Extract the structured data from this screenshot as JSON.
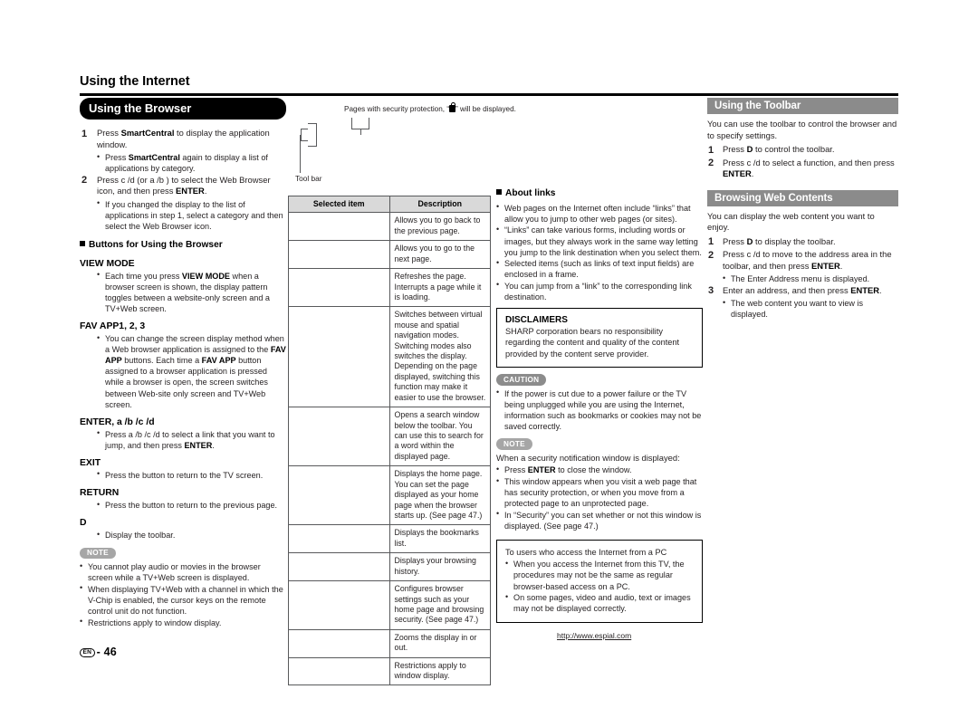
{
  "header": {
    "chapter_title": "Using the Internet"
  },
  "left_column": {
    "section_title": "Using the Browser",
    "steps": [
      {
        "num": "1",
        "text_parts": [
          "Press ",
          "SmartCentral",
          " to display the application window."
        ],
        "bullets": [
          {
            "parts": [
              "Press ",
              "SmartCentral",
              " again to display a list of applications by category."
            ]
          }
        ]
      },
      {
        "num": "2",
        "text_parts": [
          "Press c /d (or a /b ) to select the Web Browser icon, and then press ",
          "ENTER",
          "."
        ],
        "bullets": [
          {
            "parts": [
              "If you changed the display to the list of applications in step 1, select a category and then select the Web Browser icon."
            ]
          }
        ]
      }
    ],
    "buttons_heading": "Buttons for Using the Browser",
    "button_entries": [
      {
        "keyword": "VIEW MODE",
        "bullets": [
          {
            "parts": [
              "Each time you press ",
              "VIEW MODE",
              " when a browser screen is shown, the display pattern toggles between a website-only screen and a TV+Web screen."
            ]
          }
        ]
      },
      {
        "keyword": "FAV APP1, 2, 3",
        "bullets": [
          {
            "parts": [
              "You can change the screen display method when a Web browser application is assigned to the ",
              "FAV APP",
              " buttons. Each time a ",
              "FAV APP",
              " button assigned to a browser application is pressed while a browser is open, the screen switches between Web-site only screen and TV+Web screen."
            ]
          }
        ]
      },
      {
        "keyword": "ENTER, a /b /c /d",
        "bullets": [
          {
            "parts": [
              "Press a /b /c /d  to select a link that you want to jump, and then press ",
              "ENTER",
              "."
            ]
          }
        ]
      },
      {
        "keyword": "EXIT",
        "bullets": [
          {
            "parts": [
              "Press the button to return to the TV screen."
            ]
          }
        ]
      },
      {
        "keyword": "RETURN",
        "bullets": [
          {
            "parts": [
              "Press the button to return to the previous page."
            ]
          }
        ]
      },
      {
        "keyword": "D",
        "bullets": [
          {
            "parts": [
              "Display the toolbar."
            ]
          }
        ]
      }
    ],
    "note_badge": "NOTE",
    "notes": [
      {
        "parts": [
          "You cannot play audio or movies in the browser screen while a TV+Web screen is displayed."
        ]
      },
      {
        "parts": [
          "When displaying TV+Web with a channel in which the V-Chip is enabled, the cursor keys on the remote control unit do not function."
        ]
      },
      {
        "parts": [
          "Restrictions apply to window display."
        ]
      }
    ]
  },
  "mid_column": {
    "diagram": {
      "caption_before": "Pages with security protection, “",
      "caption_icon": "lock-icon",
      "caption_after": "” will be displayed.",
      "toolbar_label": "Tool bar"
    },
    "table": {
      "headers": [
        "Selected item",
        "Description"
      ],
      "rows": [
        {
          "selected_item": "",
          "description": "Allows you to go back to the previous page."
        },
        {
          "selected_item": "",
          "description": "Allows you to go to the next page."
        },
        {
          "selected_item": "",
          "description": "Refreshes the page.\nInterrupts a page while it is loading."
        },
        {
          "selected_item": "",
          "description": "Switches between virtual mouse and spatial navigation modes. Switching modes also switches the display. Depending on the page displayed, switching this function may make it easier to use the browser."
        },
        {
          "selected_item": "",
          "description": "Opens a search window below the toolbar. You can use this to search for a word within the displayed page."
        },
        {
          "selected_item": "",
          "description": "Displays the home page. You can set the page displayed as your home page when the browser starts up. (See page 47.)"
        },
        {
          "selected_item": "",
          "description": "Displays the bookmarks list."
        },
        {
          "selected_item": "",
          "description": "Displays your browsing history."
        },
        {
          "selected_item": "",
          "description": "Configures browser settings such as your home page and browsing security. (See page 47.)"
        },
        {
          "selected_item": "",
          "description": "Zooms the display in or out."
        },
        {
          "selected_item": "",
          "description": "Restrictions apply to window display."
        }
      ]
    }
  },
  "right_column": {
    "about_links_heading": "About links",
    "about_links": [
      {
        "parts": [
          "Web pages on the Internet often include “links” that allow you to jump to other web pages (or sites)."
        ]
      },
      {
        "parts": [
          "“Links” can take various forms, including words or images, but they always work in the same way letting you jump to the link destination when you select them."
        ]
      },
      {
        "parts": [
          "Selected items (such as links of text input fields) are enclosed in a frame."
        ]
      },
      {
        "parts": [
          "You can jump from a “link” to the corresponding link destination."
        ]
      }
    ],
    "disclaimers": {
      "title": "DISCLAIMERS",
      "body": "SHARP corporation bears no responsibility regarding the content and quality of the content provided by the content serve provider."
    },
    "caution_badge": "CAUTION",
    "cautions": [
      {
        "parts": [
          "If the power is cut due to a power failure or the TV being unplugged while you are using the Internet, information such as bookmarks or cookies may not be saved correctly."
        ]
      }
    ],
    "note_badge": "NOTE",
    "note_intro": "When a security notification window is displayed:",
    "notes": [
      {
        "parts": [
          "Press ",
          "ENTER",
          " to close the window."
        ]
      },
      {
        "parts": [
          "This window appears when you visit a web page that has security protection, or when you move from a protected page to an unprotected page."
        ]
      },
      {
        "parts": [
          "In “Security” you can set whether or not this window is displayed. (See page 47.)"
        ]
      }
    ],
    "pc_users_box": {
      "title": "To users who access the Internet from a PC",
      "bullets": [
        {
          "parts": [
            "When you access the Internet from this TV, the procedures may not be the same as regular browser-based access on a PC."
          ]
        },
        {
          "parts": [
            "On some pages, video and audio, text or images may not be displayed correctly."
          ]
        }
      ]
    }
  },
  "far_column": {
    "toolbar_section": {
      "title": "Using the Toolbar",
      "intro": "You can use the toolbar to control the browser and to specify settings.",
      "steps": [
        {
          "num": "1",
          "parts": [
            "Press ",
            "D",
            " to control the toolbar."
          ],
          "bullets": []
        },
        {
          "num": "2",
          "parts": [
            "Press c /d  to select a function, and then press ",
            "ENTER",
            "."
          ],
          "bullets": []
        }
      ]
    },
    "browsing_section": {
      "title": "Browsing Web Contents",
      "intro": "You can display the web content you want to enjoy.",
      "steps": [
        {
          "num": "1",
          "parts": [
            "Press ",
            "D",
            " to display the toolbar."
          ],
          "bullets": []
        },
        {
          "num": "2",
          "parts": [
            "Press c /d  to move to the address area in the toolbar, and then press ",
            "ENTER",
            "."
          ],
          "bullets": [
            {
              "parts": [
                "The Enter Address menu is displayed."
              ]
            }
          ]
        },
        {
          "num": "3",
          "parts": [
            "Enter an address, and then press ",
            "ENTER",
            "."
          ],
          "bullets": [
            {
              "parts": [
                "The web content you want to view is displayed."
              ]
            }
          ]
        }
      ]
    }
  },
  "footer": {
    "espial_url": "http://www.espial.com",
    "region_code": "EN",
    "separator": "-",
    "page_number": "46"
  }
}
